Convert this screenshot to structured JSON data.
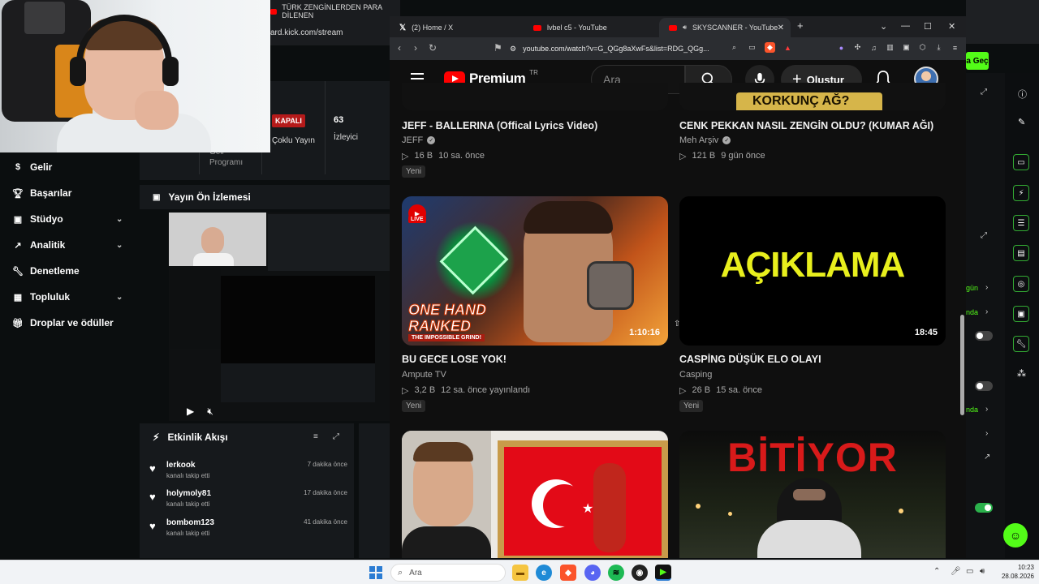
{
  "kick": {
    "bg_tab_title": "TÜRK ZENGİNLERDEN PARA DİLENEN",
    "bg_url": "ard.kick.com/stream",
    "status_badge": "KAPALI",
    "multi_stream": "Çoklu Yayın",
    "viewers_count": "63",
    "viewers_label": "İzleyici",
    "program_line1": "Geli",
    "program_line2": "Programı",
    "nav": [
      {
        "label": "Gelir",
        "icon": "dollar-icon",
        "chevron": false
      },
      {
        "label": "Başarılar",
        "icon": "trophy-icon",
        "chevron": false
      },
      {
        "label": "Stüdyo",
        "icon": "studio-icon",
        "chevron": true
      },
      {
        "label": "Analitik",
        "icon": "analytics-icon",
        "chevron": true
      },
      {
        "label": "Denetleme",
        "icon": "wrench-icon",
        "chevron": false
      },
      {
        "label": "Topluluk",
        "icon": "community-icon",
        "chevron": true
      },
      {
        "label": "Droplar ve ödüller",
        "icon": "gift-icon",
        "chevron": false
      }
    ],
    "preview_title": "Yayın Ön İzlemesi",
    "activity_title": "Etkinlik Akışı",
    "activity": [
      {
        "user": "lerkook",
        "action": "kanalı takip etti",
        "time": "7 dakika önce"
      },
      {
        "user": "holymoly81",
        "action": "kanalı takip etti",
        "time": "17 dakika önce"
      },
      {
        "user": "bombom123",
        "action": "kanalı takip etti",
        "time": "41 dakika önce"
      }
    ],
    "right_panel": {
      "green_btn": "a Geç",
      "gun": "gün",
      "nda1": "nda",
      "nda2": "nda"
    }
  },
  "browser": {
    "tabs": [
      {
        "title": "(2) Home / X",
        "favicon": "x-logo-icon",
        "active": false
      },
      {
        "title": "lvbel c5 - YouTube",
        "favicon": "youtube-icon",
        "active": false
      },
      {
        "title": "SKYSCANNER - YouTube",
        "favicon": "youtube-icon",
        "active": true
      }
    ],
    "url": "youtube.com/watch?v=G_QGg8aXwFs&list=RDG_QGg..."
  },
  "youtube": {
    "logo_text": "Premium",
    "region": "TR",
    "search_placeholder": "Ara",
    "create_label": "Oluştur",
    "videos": [
      {
        "title": "JEFF - BALLERINA (Offical Lyrics Video)",
        "channel": "JEFF",
        "verified": true,
        "views": "16 B",
        "age": "10 sa. önce",
        "badge": "Yeni"
      },
      {
        "title": "CENK PEKKAN NASIL ZENGİN OLDU? (KUMAR AĞI)",
        "channel": "Meh Arşiv",
        "verified": true,
        "views": "121 B",
        "age": "9 gün önce",
        "badge": ""
      },
      {
        "title": "BU GECE LOSE YOK!",
        "channel": "Ampute TV",
        "verified": false,
        "views": "3,2 B",
        "age": "12 sa. önce yayınlandı",
        "badge": "Yeni",
        "duration": "1:10:16",
        "thumb_text1": "ONE HAND",
        "thumb_text2": "RANKED",
        "thumb_text3": "THE IMPOSSIBLE GRIND!",
        "live": "LIVE"
      },
      {
        "title": "CASPİNG DÜŞÜK ELO OLAYI",
        "channel": "Casping",
        "verified": false,
        "views": "26 B",
        "age": "15 sa. önce",
        "badge": "Yeni",
        "duration": "18:45",
        "thumb_text": "AÇIKLAMA"
      },
      {
        "title": "",
        "thumb_text": ""
      },
      {
        "title": "",
        "thumb_text": "BİTİYOR"
      }
    ],
    "top_thumb_partial_text": "KORKUNÇ AĞ?"
  },
  "taskbar": {
    "search_placeholder": "Ara",
    "time": "10:23",
    "date": "28.08.2026"
  }
}
